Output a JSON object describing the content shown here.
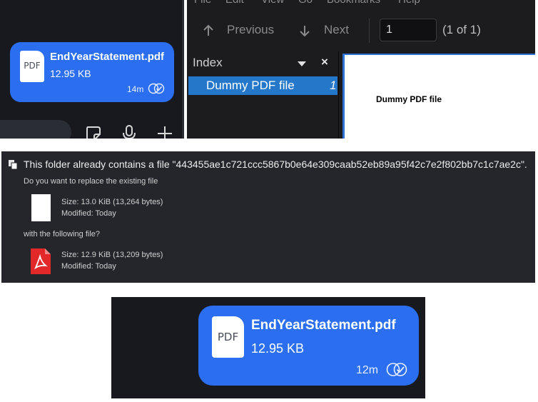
{
  "chat_message": {
    "file_icon_label": "PDF",
    "file_name": "EndYearStatement.pdf",
    "file_size": "12.95 KB",
    "time": "14m"
  },
  "pdf_viewer": {
    "menu": [
      "File",
      "Edit",
      "View",
      "Go",
      "Bookmarks",
      "Help"
    ],
    "previous_label": "Previous",
    "next_label": "Next",
    "page_input": "1",
    "page_count": "(1 of 1)",
    "index_title": "Index",
    "close_glyph": "×",
    "index_items": [
      {
        "label": "Dummy PDF file",
        "page": "1"
      }
    ],
    "page_text": "Dummy PDF file"
  },
  "replace_dialog": {
    "title": "This folder already contains a file \"443455ae1c721ccc5867b0e64e309caab52eb89a95f42c7e2f802bb7c1c7ae2c\".",
    "question_existing": "Do you want to replace the existing file",
    "existing_size": "Size: 13.0 KiB (13,264 bytes)",
    "existing_modified": "Modified: Today",
    "question_new": "with the following file?",
    "new_size": "Size: 12.9 KiB (13,209 bytes)",
    "new_modified": "Modified: Today"
  },
  "chat_message_zoomed": {
    "file_icon_label": "PDF",
    "file_name": "EndYearStatement.pdf",
    "file_size": "12.95 KB",
    "time": "12m"
  },
  "colors": {
    "bubble": "#2b6ff0",
    "chat_bg": "#17191f",
    "viewer_bg": "#1c1c1f",
    "index_selected": "#2477c9",
    "dialog_bg": "#25262b",
    "pdf_red": "#e3282a"
  },
  "icons": [
    "pdf-file-icon",
    "read-receipt-icon",
    "sticker-icon",
    "microphone-icon",
    "plus-icon",
    "arrow-up-icon",
    "arrow-down-icon",
    "dropdown-caret-icon",
    "close-icon",
    "warning-icon",
    "blank-document-icon",
    "acrobat-pdf-icon"
  ]
}
